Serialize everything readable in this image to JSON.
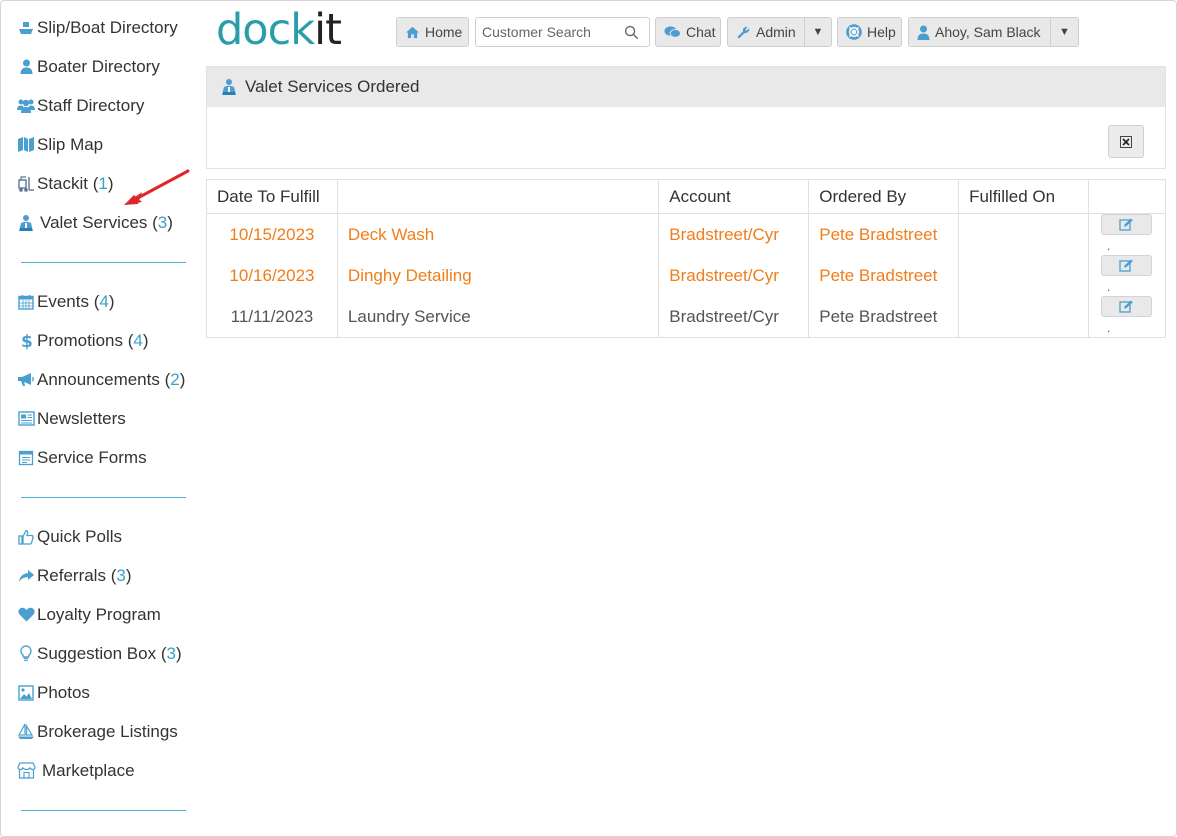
{
  "sidebar": {
    "items": [
      {
        "label": "Slip/Boat Directory",
        "count": "",
        "icon": "boat-icon"
      },
      {
        "label": "Boater Directory",
        "count": "",
        "icon": "user-icon"
      },
      {
        "label": "Staff Directory",
        "count": "",
        "icon": "users-icon"
      },
      {
        "label": "Slip Map",
        "count": "",
        "icon": "map-icon"
      },
      {
        "label": "Stackit",
        "count": "1",
        "icon": "forklift-icon"
      },
      {
        "label": "Valet Services",
        "count": "3",
        "icon": "valet-icon"
      }
    ],
    "items2": [
      {
        "label": "Events",
        "count": "4",
        "icon": "calendar-icon"
      },
      {
        "label": "Promotions",
        "count": "4",
        "icon": "dollar-icon"
      },
      {
        "label": "Announcements",
        "count": "2",
        "icon": "megaphone-icon"
      },
      {
        "label": "Newsletters",
        "count": "",
        "icon": "newspaper-icon"
      },
      {
        "label": "Service Forms",
        "count": "",
        "icon": "form-icon"
      }
    ],
    "items3": [
      {
        "label": "Quick Polls",
        "count": "",
        "icon": "thumbs-up-icon"
      },
      {
        "label": "Referrals",
        "count": "3",
        "icon": "share-icon"
      },
      {
        "label": "Loyalty Program",
        "count": "",
        "icon": "heart-icon"
      },
      {
        "label": "Suggestion Box",
        "count": "3",
        "icon": "lightbulb-icon"
      },
      {
        "label": "Photos",
        "count": "",
        "icon": "photo-icon"
      },
      {
        "label": "Brokerage Listings",
        "count": "",
        "icon": "sailboat-icon"
      },
      {
        "label": "Marketplace",
        "count": "",
        "icon": "store-icon"
      }
    ]
  },
  "header": {
    "logo_dock": "dock",
    "logo_it": "it",
    "home_label": "Home",
    "search_placeholder": "Customer Search",
    "chat_label": "Chat",
    "admin_label": "Admin",
    "help_label": "Help",
    "user_label": "Ahoy, Sam Black"
  },
  "panel": {
    "title": "Valet Services Ordered"
  },
  "table": {
    "headers": [
      "Date To Fulfill",
      "",
      "Account",
      "Ordered By",
      "Fulfilled On",
      ""
    ],
    "rows": [
      {
        "date": "10/15/2023",
        "service": "Deck Wash",
        "account": "Bradstreet/Cyr",
        "ordered_by": "Pete Bradstreet",
        "fulfilled_on": "",
        "highlight": true
      },
      {
        "date": "10/16/2023",
        "service": "Dinghy Detailing",
        "account": "Bradstreet/Cyr",
        "ordered_by": "Pete Bradstreet",
        "fulfilled_on": "",
        "highlight": true
      },
      {
        "date": "11/11/2023",
        "service": "Laundry Service",
        "account": "Bradstreet/Cyr",
        "ordered_by": "Pete Bradstreet",
        "fulfilled_on": "",
        "highlight": false
      }
    ],
    "trail": "."
  },
  "colors": {
    "accent": "#3aa3c9",
    "highlight_text": "#f07d1a",
    "logo": "#2a9ea8",
    "annotation_arrow": "#e0262b"
  }
}
